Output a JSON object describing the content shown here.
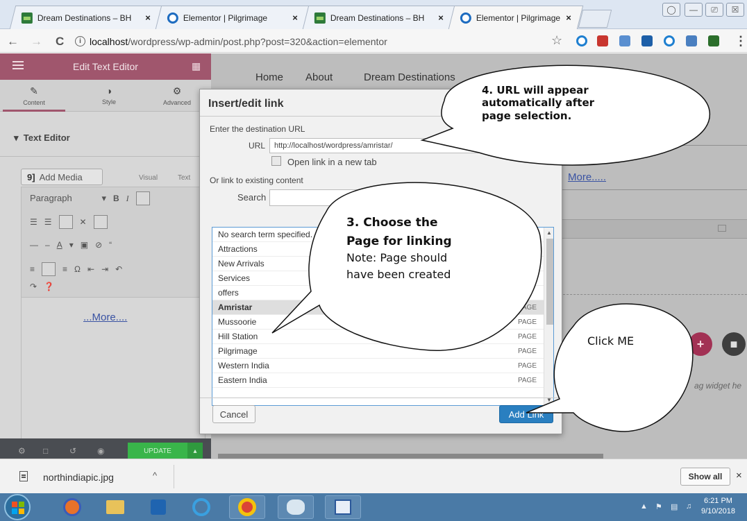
{
  "browser": {
    "tabs": [
      {
        "title": "Dream Destinations – BH",
        "icon": "wordpress-icon",
        "active": false
      },
      {
        "title": "Elementor | Pilgrimage",
        "icon": "elementor-icon",
        "active": false
      },
      {
        "title": "Dream Destinations – BH",
        "icon": "wordpress-icon",
        "active": false
      },
      {
        "title": "Elementor | Pilgrimage",
        "icon": "elementor-icon",
        "active": true
      }
    ],
    "tab_close": "×",
    "url_host": "localhost",
    "url_path": "/wordpress/wp-admin/post.php?post=320&action=elementor",
    "info_glyph": "i",
    "star_glyph": "☆",
    "menu_glyph": "⋮",
    "back_glyph": "←",
    "forward_glyph": "→",
    "reload_glyph": "C",
    "win_close": "☒",
    "win_max": "⎚",
    "win_min": "—"
  },
  "editor_panel": {
    "title": "Edit Text Editor",
    "tabs": [
      {
        "label": "Content",
        "glyph": "✎"
      },
      {
        "label": "Style",
        "glyph": "◑"
      },
      {
        "label": "Advanced",
        "glyph": "⚙"
      }
    ],
    "section_title": "Text Editor",
    "section_caret": "▾",
    "add_media_label": "Add Media",
    "add_media_glyph": "9]",
    "visual_tab": "Visual",
    "text_tab": "Text",
    "paragraph_select": "Paragraph",
    "paragraph_caret": "▾",
    "bold": "B",
    "italic": "I",
    "content_link": "...More....",
    "update_label": "UPDATE",
    "update_caret": "▴"
  },
  "site_preview": {
    "nav": [
      "Home",
      "About",
      "Dream Destinations"
    ],
    "more_link": "More.....",
    "plus_glyph": "+",
    "folder_glyph": "■",
    "drag_hint": "ag widget he"
  },
  "link_dialog": {
    "title": "Insert/edit link",
    "url_section_label": "Enter the destination URL",
    "url_label": "URL",
    "url_value": "http://localhost/wordpress/amristar/",
    "new_tab_label": "Open link in a new tab",
    "existing_label": "Or link to existing content",
    "search_label": "Search",
    "search_value": "",
    "results": [
      {
        "title": "No search term specified. Showing recent items.",
        "type": "",
        "selected": false
      },
      {
        "title": "Attractions",
        "type": "",
        "selected": false
      },
      {
        "title": "New Arrivals",
        "type": "",
        "selected": false
      },
      {
        "title": "Services",
        "type": "",
        "selected": false
      },
      {
        "title": "offers",
        "type": "",
        "selected": false
      },
      {
        "title": "Amristar",
        "type": "PAGE",
        "selected": true
      },
      {
        "title": "Mussoorie",
        "type": "PAGE",
        "selected": false
      },
      {
        "title": "Hill Station",
        "type": "PAGE",
        "selected": false
      },
      {
        "title": "Pilgrimage",
        "type": "PAGE",
        "selected": false
      },
      {
        "title": "Western India",
        "type": "PAGE",
        "selected": false
      },
      {
        "title": "Eastern India",
        "type": "PAGE",
        "selected": false
      }
    ],
    "cancel_label": "Cancel",
    "add_link_label": "Add Link",
    "scroll_up": "▲",
    "scroll_down": "▼"
  },
  "callouts": {
    "step4": [
      "4. URL will appear",
      "automatically after",
      "page selection."
    ],
    "step3_bold": [
      "3. Choose the",
      "Page for linking"
    ],
    "step3_note": [
      "Note: Page should",
      "have been created"
    ],
    "click_me": "Click ME"
  },
  "download_bar": {
    "filename": "northindiapic.jpg",
    "caret": "^",
    "show_all": "Show all",
    "close": "×"
  },
  "taskbar": {
    "time": "6:21 PM",
    "date": "9/10/2018",
    "tray_up": "▲"
  },
  "colors": {
    "elementor_header": "#a0566d",
    "update_green": "#39b54a",
    "add_link_blue": "#2a7fc0",
    "plus_red": "#a23154",
    "taskbar_blue": "#4a7aa6"
  }
}
